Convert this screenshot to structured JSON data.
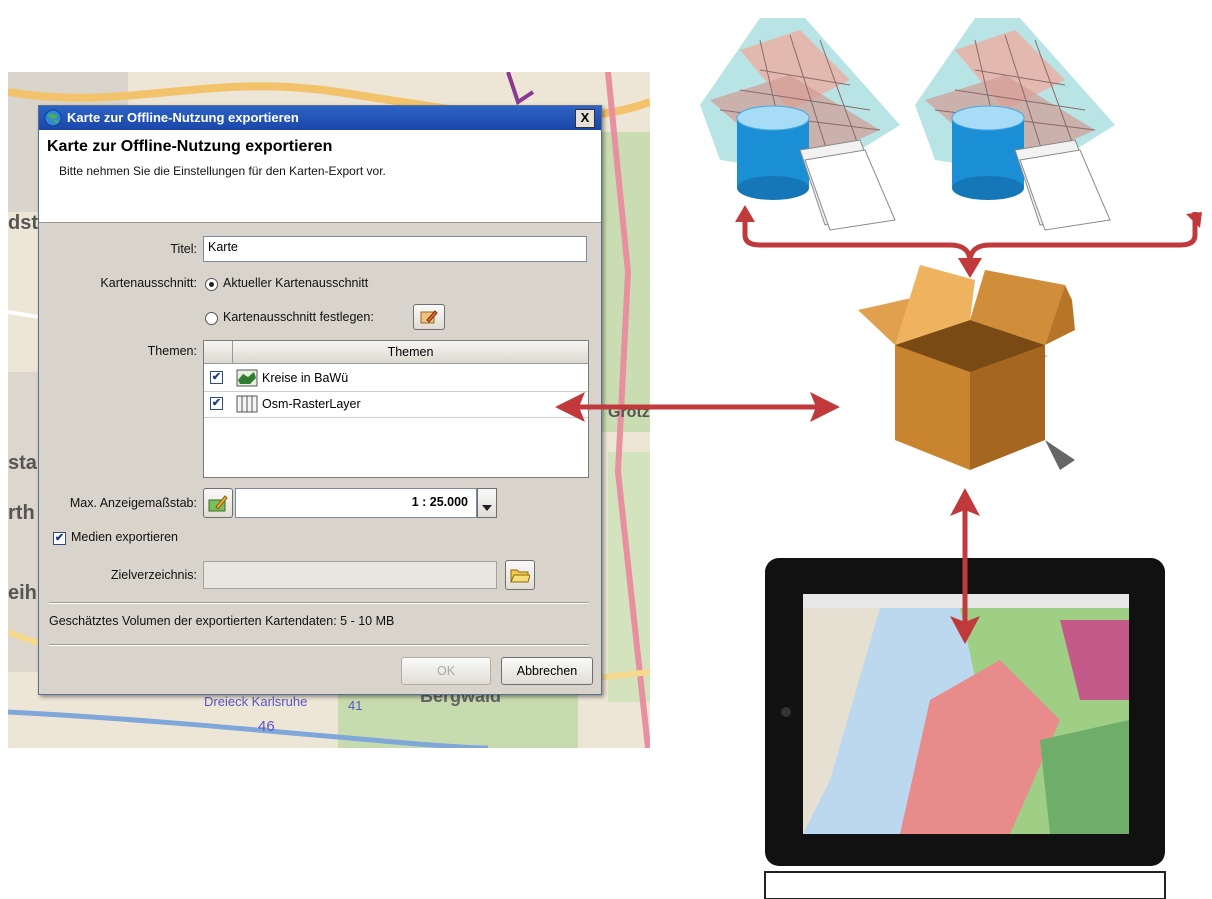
{
  "map": {
    "labels": [
      "dsta",
      "sta",
      "rth",
      "eih",
      "Grötz",
      "Dreieck Karlsruhe",
      "Bergwald",
      "41",
      "46"
    ]
  },
  "dialog": {
    "window_title": "Karte zur Offline-Nutzung exportieren",
    "close_glyph": "X",
    "header_title": "Karte zur Offline-Nutzung exportieren",
    "header_subtitle": "Bitte nehmen Sie die Einstellungen für den Karten-Export vor.",
    "title_label": "Titel:",
    "title_value": "Karte",
    "extent_label": "Kartenausschnitt:",
    "extent_option_current": "Aktueller Kartenausschnitt",
    "extent_option_define": "Kartenausschnitt festlegen:",
    "themes_label": "Themen:",
    "themes_column": "Themen",
    "themes": [
      {
        "name": "Kreise in BaWü",
        "checked": true,
        "icon": "polygon-layer-icon"
      },
      {
        "name": "Osm-RasterLayer",
        "checked": true,
        "icon": "raster-layer-icon"
      }
    ],
    "scale_label": "Max. Anzeigemaßstab:",
    "scale_value": "1 : 25.000",
    "media_label": "Medien exportieren",
    "media_checked": true,
    "target_label": "Zielverzeichnis:",
    "target_value": "",
    "volume_text": "Geschätztes Volumen der exportierten Kartendaten: 5 - 10 MB",
    "ok_label": "OK",
    "cancel_label": "Abbrechen"
  },
  "colors": {
    "arrow": "#c0393b",
    "titlebar": "#1f4fb5",
    "database": "#1b8fd6",
    "box": "#c9842f"
  }
}
